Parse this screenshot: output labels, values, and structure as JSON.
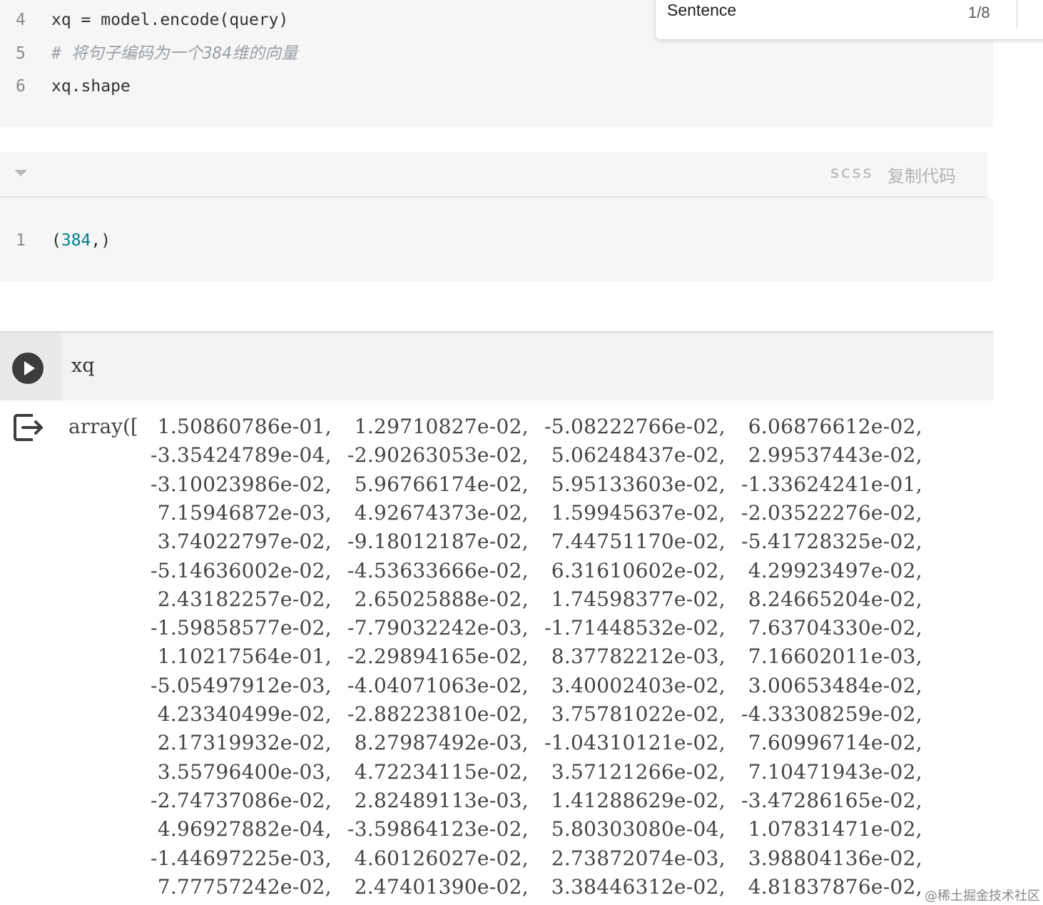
{
  "code_top": {
    "lines": [
      {
        "num": "4",
        "text": "xq = model.encode(query)"
      },
      {
        "num": "5",
        "text": "# 将句子编码为一个384维的向量"
      },
      {
        "num": "6",
        "text": "xq.shape"
      }
    ]
  },
  "find_widget": {
    "query": "Sentence",
    "count": "1/8"
  },
  "output_block": {
    "language": "scss",
    "copy_label": "复制代码",
    "line_num": "1",
    "value": "(384,)"
  },
  "cell": {
    "code": "xq"
  },
  "array_output": {
    "prefix": "array([",
    "rows": [
      [
        " 1.50860786e-01,",
        " 1.29710827e-02,",
        "-5.08222766e-02,",
        " 6.06876612e-02,"
      ],
      [
        "-3.35424789e-04,",
        "-2.90263053e-02,",
        " 5.06248437e-02,",
        " 2.99537443e-02,"
      ],
      [
        "-3.10023986e-02,",
        " 5.96766174e-02,",
        " 5.95133603e-02,",
        "-1.33624241e-01,"
      ],
      [
        " 7.15946872e-03,",
        " 4.92674373e-02,",
        " 1.59945637e-02,",
        "-2.03522276e-02,"
      ],
      [
        " 3.74022797e-02,",
        "-9.18012187e-02,",
        " 7.44751170e-02,",
        "-5.41728325e-02,"
      ],
      [
        "-5.14636002e-02,",
        "-4.53633666e-02,",
        " 6.31610602e-02,",
        " 4.29923497e-02,"
      ],
      [
        " 2.43182257e-02,",
        " 2.65025888e-02,",
        " 1.74598377e-02,",
        " 8.24665204e-02,"
      ],
      [
        "-1.59858577e-02,",
        "-7.79032242e-03,",
        "-1.71448532e-02,",
        " 7.63704330e-02,"
      ],
      [
        " 1.10217564e-01,",
        "-2.29894165e-02,",
        " 8.37782212e-03,",
        " 7.16602011e-03,"
      ],
      [
        "-5.05497912e-03,",
        "-4.04071063e-02,",
        " 3.40002403e-02,",
        " 3.00653484e-02,"
      ],
      [
        " 4.23340499e-02,",
        "-2.88223810e-02,",
        " 3.75781022e-02,",
        "-4.33308259e-02,"
      ],
      [
        " 2.17319932e-02,",
        " 8.27987492e-03,",
        "-1.04310121e-02,",
        " 7.60996714e-02,"
      ],
      [
        " 3.55796400e-03,",
        " 4.72234115e-02,",
        " 3.57121266e-02,",
        " 7.10471943e-02,"
      ],
      [
        "-2.74737086e-02,",
        " 2.82489113e-03,",
        " 1.41288629e-02,",
        "-3.47286165e-02,"
      ],
      [
        " 4.96927882e-04,",
        "-3.59864123e-02,",
        " 5.80303080e-04,",
        " 1.07831471e-02,"
      ],
      [
        "-1.44697225e-03,",
        " 4.60126027e-02,",
        " 2.73872074e-03,",
        " 3.98804136e-02,"
      ],
      [
        " 7.77757242e-02,",
        " 2.47401390e-02,",
        " 3.38446312e-02,",
        " 4.81837876e-02,"
      ]
    ]
  },
  "watermark": "@稀土掘金技术社区"
}
